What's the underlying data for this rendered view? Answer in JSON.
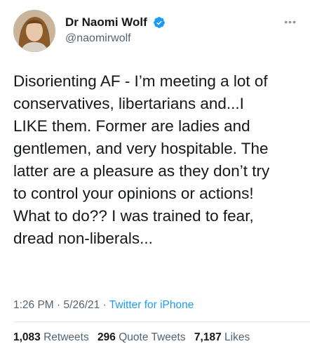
{
  "author": {
    "display_name": "Dr Naomi Wolf",
    "handle": "@naomirwolf",
    "verified": true
  },
  "more_icon": "ellipsis-icon",
  "tweet": {
    "text": "Disorienting AF - I’m meeting a lot of\nconservatives, libertarians and...I\nLIKE them. Former are ladies and\ngentlemen, and very hospitable. The\nlatter are a pleasure as they don’t try\nto control your opinions or actions!\nWhat to do?? I was trained to fear,\ndread non-liberals...",
    "time": "1:26 PM",
    "date": "5/26/21",
    "separator": "·",
    "source": "Twitter for iPhone"
  },
  "stats": {
    "retweets_count": "1,083",
    "retweets_label": "Retweets",
    "quote_count": "296",
    "quote_label": "Quote Tweets",
    "likes_count": "7,187",
    "likes_label": "Likes"
  },
  "colors": {
    "link_blue": "#1d9bf0",
    "secondary_gray": "#536471",
    "verified_blue": "#1d9bf0"
  }
}
